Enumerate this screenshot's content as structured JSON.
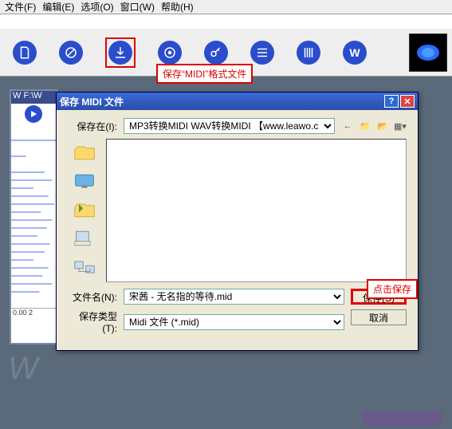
{
  "menu": {
    "file": "文件(F)",
    "edit": "编辑(E)",
    "options": "选项(O)",
    "window": "窗口(W)",
    "help": "帮助(H)"
  },
  "callout": {
    "toolbar": "保存“MIDI”格式文件",
    "save": "点击保存"
  },
  "wave": {
    "title": "W F:\\W",
    "ruler": "0.00  2"
  },
  "dialog": {
    "title": "保存 MIDI 文件",
    "savein_label": "保存在(I):",
    "savein_value": "MP3转换MIDI WAV转换MIDI 【www.leawo.c",
    "filename_label": "文件名(N):",
    "filename_value": "宋茜 - 无名指的等待.mid",
    "filetype_label": "保存类型(T):",
    "filetype_value": "Midi 文件 (*.mid)",
    "save_btn": "保存(S)",
    "cancel_btn": "取消"
  }
}
